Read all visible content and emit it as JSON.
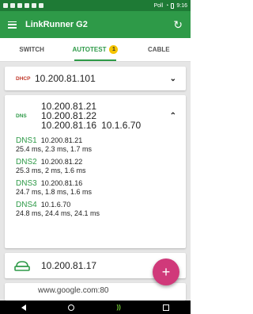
{
  "statusbar": {
    "carrier": "Poll",
    "time": "9:16"
  },
  "appbar": {
    "title": "LinkRunner G2"
  },
  "tabs": [
    {
      "label": "SWITCH"
    },
    {
      "label": "AUTOTEST",
      "badge": "1"
    },
    {
      "label": "CABLE"
    }
  ],
  "dhcp": {
    "tag": "DHCP",
    "ip": "10.200.81.101"
  },
  "dns": {
    "tag": "DNS",
    "ips_line1": "10.200.81.21",
    "ips_line2": "10.200.81.22",
    "ips_line3a": "10.200.81.16",
    "ips_line3b": "10.1.6.70",
    "servers": [
      {
        "name": "DNS1",
        "ip": "10.200.81.21",
        "times": "25.4 ms, 2.3 ms, 1.7 ms"
      },
      {
        "name": "DNS2",
        "ip": "10.200.81.22",
        "times": "25.3 ms, 2 ms, 1.6 ms"
      },
      {
        "name": "DNS3",
        "ip": "10.200.81.16",
        "times": "24.7 ms, 1.8 ms, 1.6 ms"
      },
      {
        "name": "DNS4",
        "ip": "10.1.6.70",
        "times": "24.8 ms, 24.4 ms, 24.1 ms"
      }
    ]
  },
  "gateway": {
    "ip": "10.200.81.17"
  },
  "web": {
    "text": "www.google.com:80"
  },
  "colors": {
    "primary": "#2e9a48",
    "statusbar": "#1e7a35",
    "fab": "#d0397a",
    "dhcp_tag": "#c0392b"
  }
}
